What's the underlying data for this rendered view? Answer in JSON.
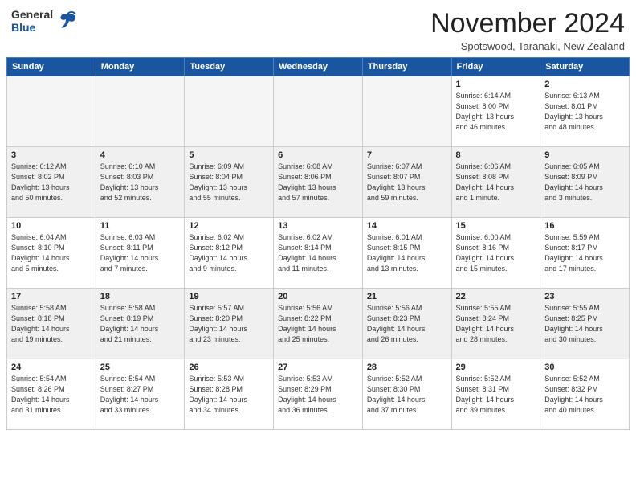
{
  "logo": {
    "general": "General",
    "blue": "Blue"
  },
  "title": "November 2024",
  "location": "Spotswood, Taranaki, New Zealand",
  "weekdays": [
    "Sunday",
    "Monday",
    "Tuesday",
    "Wednesday",
    "Thursday",
    "Friday",
    "Saturday"
  ],
  "weeks": [
    [
      {
        "day": "",
        "info": "",
        "empty": true
      },
      {
        "day": "",
        "info": "",
        "empty": true
      },
      {
        "day": "",
        "info": "",
        "empty": true
      },
      {
        "day": "",
        "info": "",
        "empty": true
      },
      {
        "day": "",
        "info": "",
        "empty": true
      },
      {
        "day": "1",
        "info": "Sunrise: 6:14 AM\nSunset: 8:00 PM\nDaylight: 13 hours\nand 46 minutes."
      },
      {
        "day": "2",
        "info": "Sunrise: 6:13 AM\nSunset: 8:01 PM\nDaylight: 13 hours\nand 48 minutes."
      }
    ],
    [
      {
        "day": "3",
        "info": "Sunrise: 6:12 AM\nSunset: 8:02 PM\nDaylight: 13 hours\nand 50 minutes."
      },
      {
        "day": "4",
        "info": "Sunrise: 6:10 AM\nSunset: 8:03 PM\nDaylight: 13 hours\nand 52 minutes."
      },
      {
        "day": "5",
        "info": "Sunrise: 6:09 AM\nSunset: 8:04 PM\nDaylight: 13 hours\nand 55 minutes."
      },
      {
        "day": "6",
        "info": "Sunrise: 6:08 AM\nSunset: 8:06 PM\nDaylight: 13 hours\nand 57 minutes."
      },
      {
        "day": "7",
        "info": "Sunrise: 6:07 AM\nSunset: 8:07 PM\nDaylight: 13 hours\nand 59 minutes."
      },
      {
        "day": "8",
        "info": "Sunrise: 6:06 AM\nSunset: 8:08 PM\nDaylight: 14 hours\nand 1 minute."
      },
      {
        "day": "9",
        "info": "Sunrise: 6:05 AM\nSunset: 8:09 PM\nDaylight: 14 hours\nand 3 minutes."
      }
    ],
    [
      {
        "day": "10",
        "info": "Sunrise: 6:04 AM\nSunset: 8:10 PM\nDaylight: 14 hours\nand 5 minutes."
      },
      {
        "day": "11",
        "info": "Sunrise: 6:03 AM\nSunset: 8:11 PM\nDaylight: 14 hours\nand 7 minutes."
      },
      {
        "day": "12",
        "info": "Sunrise: 6:02 AM\nSunset: 8:12 PM\nDaylight: 14 hours\nand 9 minutes."
      },
      {
        "day": "13",
        "info": "Sunrise: 6:02 AM\nSunset: 8:14 PM\nDaylight: 14 hours\nand 11 minutes."
      },
      {
        "day": "14",
        "info": "Sunrise: 6:01 AM\nSunset: 8:15 PM\nDaylight: 14 hours\nand 13 minutes."
      },
      {
        "day": "15",
        "info": "Sunrise: 6:00 AM\nSunset: 8:16 PM\nDaylight: 14 hours\nand 15 minutes."
      },
      {
        "day": "16",
        "info": "Sunrise: 5:59 AM\nSunset: 8:17 PM\nDaylight: 14 hours\nand 17 minutes."
      }
    ],
    [
      {
        "day": "17",
        "info": "Sunrise: 5:58 AM\nSunset: 8:18 PM\nDaylight: 14 hours\nand 19 minutes."
      },
      {
        "day": "18",
        "info": "Sunrise: 5:58 AM\nSunset: 8:19 PM\nDaylight: 14 hours\nand 21 minutes."
      },
      {
        "day": "19",
        "info": "Sunrise: 5:57 AM\nSunset: 8:20 PM\nDaylight: 14 hours\nand 23 minutes."
      },
      {
        "day": "20",
        "info": "Sunrise: 5:56 AM\nSunset: 8:22 PM\nDaylight: 14 hours\nand 25 minutes."
      },
      {
        "day": "21",
        "info": "Sunrise: 5:56 AM\nSunset: 8:23 PM\nDaylight: 14 hours\nand 26 minutes."
      },
      {
        "day": "22",
        "info": "Sunrise: 5:55 AM\nSunset: 8:24 PM\nDaylight: 14 hours\nand 28 minutes."
      },
      {
        "day": "23",
        "info": "Sunrise: 5:55 AM\nSunset: 8:25 PM\nDaylight: 14 hours\nand 30 minutes."
      }
    ],
    [
      {
        "day": "24",
        "info": "Sunrise: 5:54 AM\nSunset: 8:26 PM\nDaylight: 14 hours\nand 31 minutes."
      },
      {
        "day": "25",
        "info": "Sunrise: 5:54 AM\nSunset: 8:27 PM\nDaylight: 14 hours\nand 33 minutes."
      },
      {
        "day": "26",
        "info": "Sunrise: 5:53 AM\nSunset: 8:28 PM\nDaylight: 14 hours\nand 34 minutes."
      },
      {
        "day": "27",
        "info": "Sunrise: 5:53 AM\nSunset: 8:29 PM\nDaylight: 14 hours\nand 36 minutes."
      },
      {
        "day": "28",
        "info": "Sunrise: 5:52 AM\nSunset: 8:30 PM\nDaylight: 14 hours\nand 37 minutes."
      },
      {
        "day": "29",
        "info": "Sunrise: 5:52 AM\nSunset: 8:31 PM\nDaylight: 14 hours\nand 39 minutes."
      },
      {
        "day": "30",
        "info": "Sunrise: 5:52 AM\nSunset: 8:32 PM\nDaylight: 14 hours\nand 40 minutes."
      }
    ]
  ]
}
